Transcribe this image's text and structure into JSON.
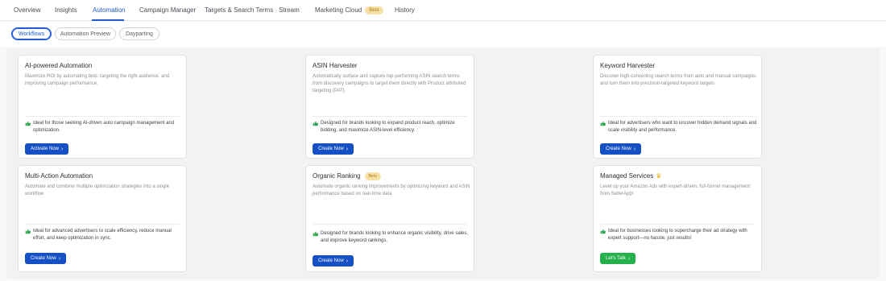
{
  "nav": {
    "tabs": [
      {
        "label": "Overview"
      },
      {
        "label": "Insights"
      },
      {
        "label": "Automation"
      },
      {
        "label": "Campaign Manager"
      },
      {
        "label": "Targets & Search Terms"
      },
      {
        "label": "Stream"
      },
      {
        "label": "Marketing Cloud"
      },
      {
        "label": "History"
      }
    ],
    "beta_label": "Beta",
    "active_tab": "Automation"
  },
  "subnav": {
    "pills": [
      {
        "label": "Workflows"
      },
      {
        "label": "Automation Preview"
      },
      {
        "label": "Dayparting"
      }
    ],
    "active_pill": "Workflows"
  },
  "cards": [
    {
      "title": "AI-powered Automation",
      "description": "Maximize ROI by automating bids, targeting the right audience, and improving campaign performance.",
      "ideal": "Ideal for those seeking AI-driven auto campaign management and optimization.",
      "button": "Activate Now"
    },
    {
      "title": "ASIN Harvester",
      "description": "Automatically surface and capture top-performing ASIN search terms from discovery campaigns to target them directly with Product attributed targeting (PAT).",
      "ideal": "Designed for brands looking to expand product reach, optimize bidding, and maximize ASIN-level efficiency.",
      "button": "Create Now"
    },
    {
      "title": "Keyword Harvester",
      "description": "Discover high-converting search terms from auto and manual campaigns, and turn them into precision-targeted keyword targets",
      "ideal": "Ideal for advertisers who want to uncover hidden demand signals and scale visibility and performance.",
      "button": "Create Now"
    },
    {
      "title": "Multi-Action Automation",
      "description": "Automate and combine multiple optimization strategies into a single workflow",
      "ideal": "Ideal for advanced advertisers to scale efficiency, reduce manual effort, and keep optimization in sync.",
      "button": "Create Now"
    },
    {
      "title": "Organic Ranking",
      "badge": "Beta",
      "description": "Automate organic ranking improvements by optimizing keyword and ASIN performance based on real-time data",
      "ideal": "Designed for brands looking to enhance organic visibility, drive sales, and improve keyword rankings.",
      "button": "Create Now"
    },
    {
      "title": "Managed Services",
      "icon": "crown-icon",
      "description": "Level up your Amazon Ads with expert-driven, full-funnel management from SellerApp!",
      "ideal": "Ideal for businesses looking to supercharge their ad strategy with expert support—no hassle, just results!",
      "button": "Let's Talk"
    }
  ],
  "colors": {
    "primary": "#1550c5",
    "active_tab": "#1f5bd6",
    "success": "#24b04a",
    "beta_bg": "#f7e0a8",
    "thumb": "#2aa44f"
  }
}
